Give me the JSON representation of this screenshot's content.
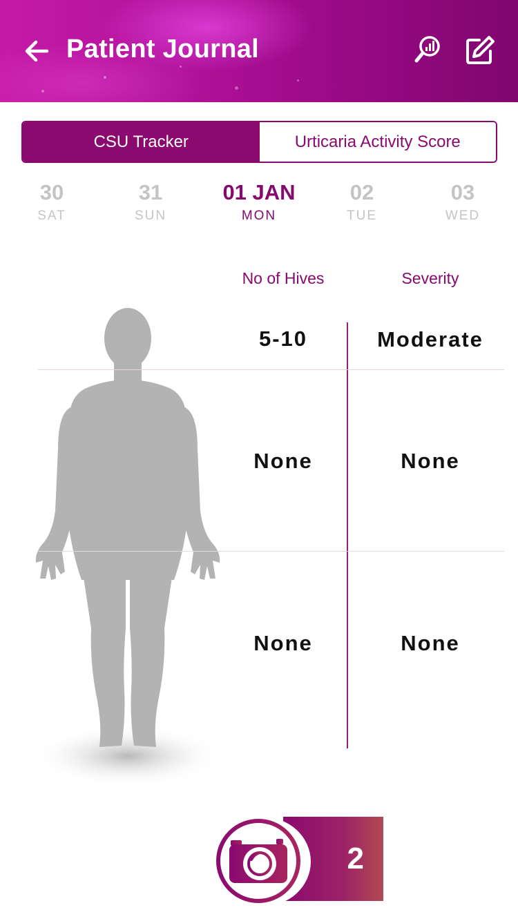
{
  "header": {
    "title": "Patient Journal",
    "back_icon": "arrow-left-icon",
    "report_icon": "magnify-chart-icon",
    "edit_icon": "edit-pencil-icon"
  },
  "tabs": [
    {
      "label": "CSU Tracker",
      "active": true
    },
    {
      "label": "Urticaria Activity Score",
      "active": false
    }
  ],
  "dates": [
    {
      "num": "30",
      "dow": "SAT",
      "selected": false
    },
    {
      "num": "31",
      "dow": "SUN",
      "selected": false
    },
    {
      "num": "01 JAN",
      "dow": "MON",
      "selected": true
    },
    {
      "num": "02",
      "dow": "TUE",
      "selected": false
    },
    {
      "num": "03",
      "dow": "WED",
      "selected": false
    }
  ],
  "table": {
    "headers": {
      "hives": "No of Hives",
      "severity": "Severity"
    },
    "rows": [
      {
        "hives": "5-10",
        "severity": "Moderate"
      },
      {
        "hives": "None",
        "severity": "None"
      },
      {
        "hives": "None",
        "severity": "None"
      }
    ]
  },
  "photos": {
    "count": "2",
    "icon": "camera-icon"
  },
  "colors": {
    "brand": "#850a6c",
    "accent": "#c41aa8",
    "muted": "#c4c4c4"
  }
}
